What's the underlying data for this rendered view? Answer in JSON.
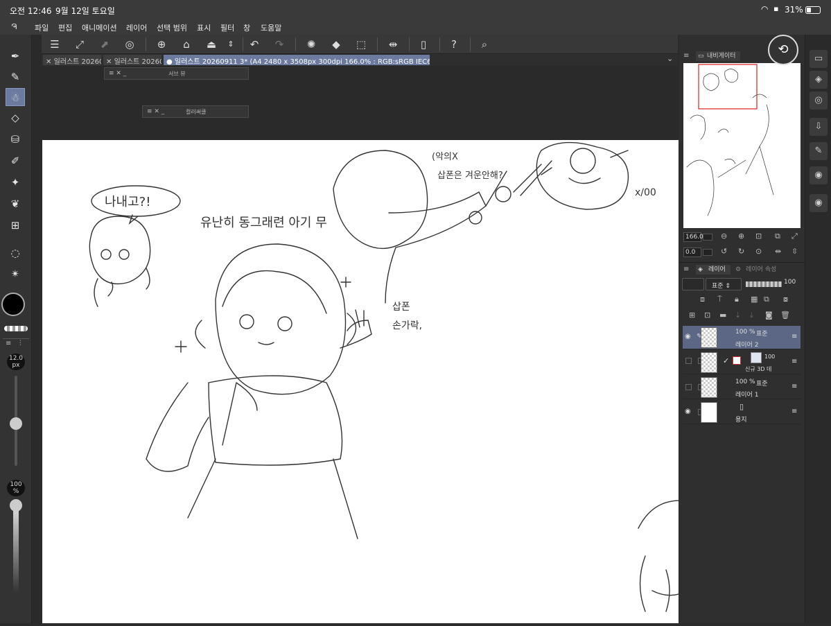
{
  "status": {
    "time": "오전 12:46",
    "date": "9월 12일 토요일",
    "battery": "31%"
  },
  "menu": [
    "파일",
    "편집",
    "애니메이션",
    "레이어",
    "선택 범위",
    "표시",
    "필터",
    "창",
    "도움말"
  ],
  "tabs": [
    {
      "label": "일러스트 20260",
      "active": false
    },
    {
      "label": "일러스트 20260",
      "active": false
    },
    {
      "label": "일러스트 20260911 3* (A4 2480 x 3508px 300dpi 166.0% : RGB:sRGB IEC61966-2.1)",
      "active": true
    }
  ],
  "float_panels": {
    "sub_view": "서브 뷰",
    "color_circle": "컬러써클"
  },
  "brush": {
    "size": "12.0",
    "size_unit": "px",
    "opacity": "100",
    "opacity_unit": "%"
  },
  "navigator": {
    "title": "내비게이터",
    "zoom": "166.0",
    "rotation": "0.0"
  },
  "layer_panel": {
    "tab_layer": "레이어",
    "tab_props": "레이어 속성",
    "blend_mode": "표준",
    "opacity": "100",
    "layers": [
      {
        "opacity": "100 %",
        "mode": "표준",
        "name": "레이어 2",
        "selected": true,
        "visible": true
      },
      {
        "opacity": "100",
        "mode": "",
        "name": "신규 3D 데",
        "selected": false,
        "visible": false
      },
      {
        "opacity": "100 %",
        "mode": "표준",
        "name": "레이어 1",
        "selected": false,
        "visible": false
      },
      {
        "opacity": "",
        "mode": "",
        "name": "용지",
        "selected": false,
        "visible": true
      }
    ]
  },
  "sketch_text": {
    "bubble": "나내고?!",
    "caption": "유난히 동그래련 아기 무",
    "note1": "(악의X",
    "note2": "삽폰은 겨운안해?",
    "note3": "삽폰",
    "note4": "손가락,",
    "note5": "x/00"
  },
  "colors": {
    "accent": "#6b7a9e",
    "panel": "#2f2f2f",
    "paper": "#ffffff"
  }
}
